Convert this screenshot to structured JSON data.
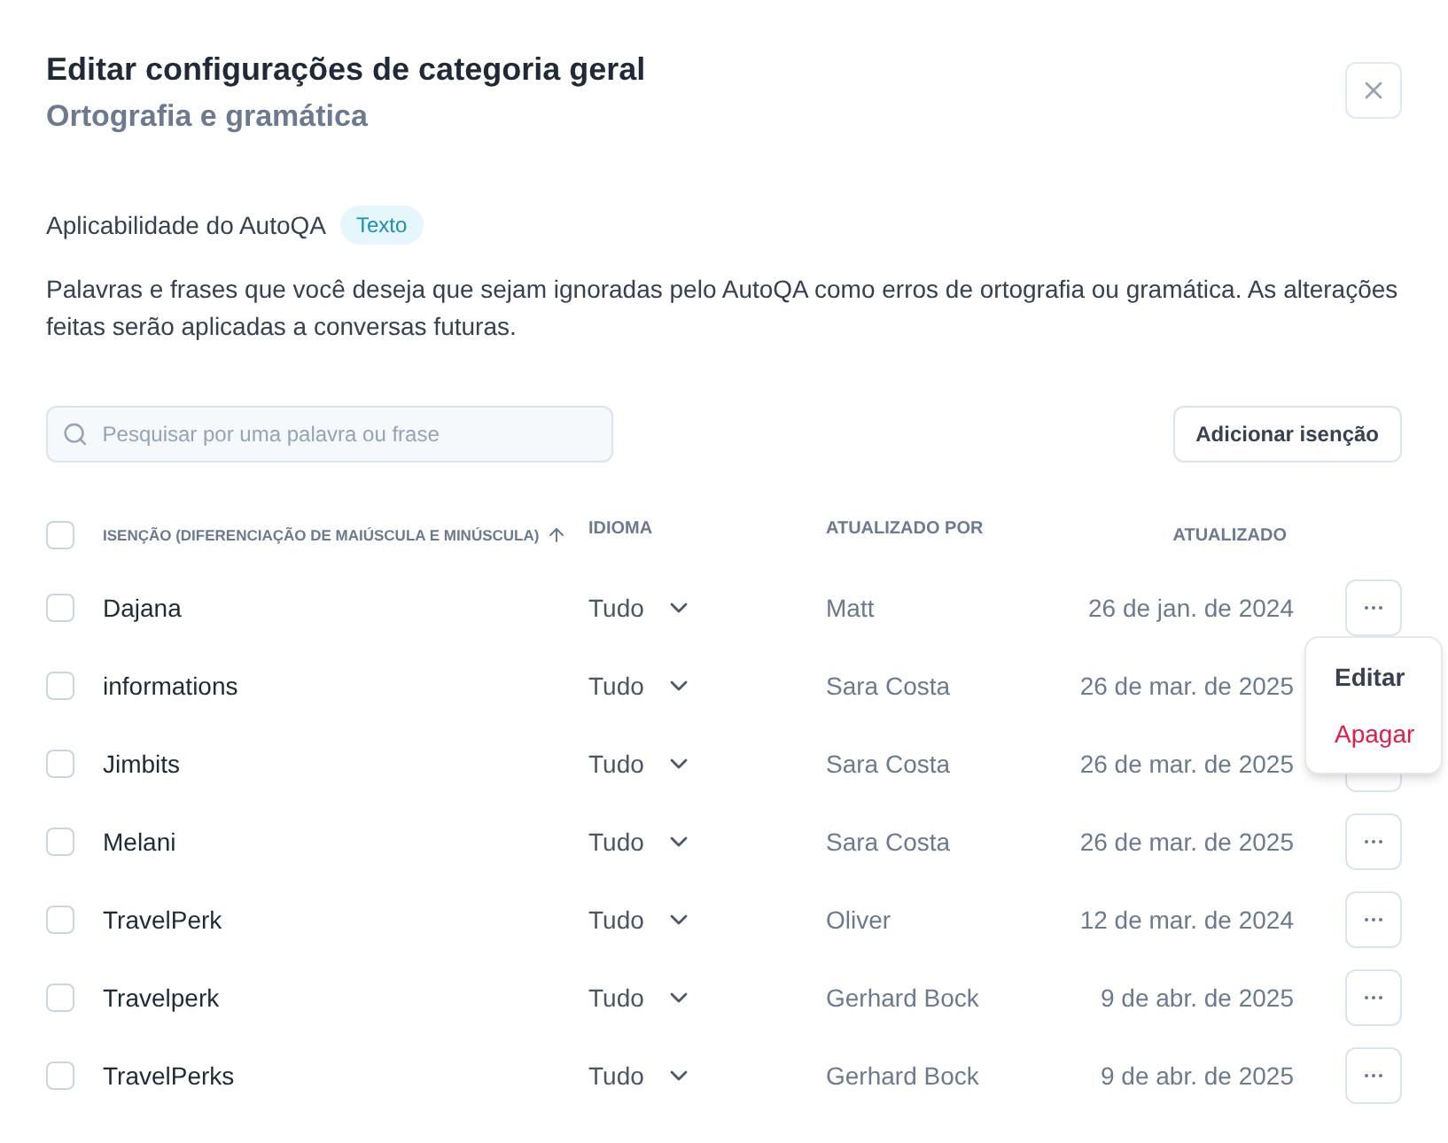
{
  "dialog": {
    "title": "Editar configurações de categoria geral",
    "subtitle": "Ortografia e gramática"
  },
  "applicability": {
    "label": "Aplicabilidade do AutoQA",
    "badge": "Texto"
  },
  "description": "Palavras e frases que você deseja que sejam ignoradas pelo AutoQA como erros de ortografia ou gramática. As alterações feitas serão aplicadas a conversas futuras.",
  "search": {
    "placeholder": "Pesquisar por uma palavra ou frase"
  },
  "add_button": "Adicionar isenção",
  "table": {
    "select_all_checked": false,
    "columns": [
      "ISENÇÃO (DIFERENCIAÇÃO DE MAIÚSCULA E MINÚSCULA)",
      "IDIOMA",
      "ATUALIZADO POR",
      "ATUALIZADO"
    ],
    "rows": [
      {
        "checked": false,
        "word": "Dajana",
        "language": "Tudo",
        "updated_by": "Matt",
        "updated": "26 de jan. de 2024"
      },
      {
        "checked": false,
        "word": "informations",
        "language": "Tudo",
        "updated_by": "Sara Costa",
        "updated": "26 de mar. de 2025"
      },
      {
        "checked": false,
        "word": "Jimbits",
        "language": "Tudo",
        "updated_by": "Sara Costa",
        "updated": "26 de mar. de 2025"
      },
      {
        "checked": false,
        "word": "Melani",
        "language": "Tudo",
        "updated_by": "Sara Costa",
        "updated": "26 de mar. de 2025"
      },
      {
        "checked": false,
        "word": "TravelPerk",
        "language": "Tudo",
        "updated_by": "Oliver",
        "updated": "12 de mar. de 2024"
      },
      {
        "checked": false,
        "word": "Travelperk",
        "language": "Tudo",
        "updated_by": "Gerhard Bock",
        "updated": "9 de abr. de 2025"
      },
      {
        "checked": false,
        "word": "TravelPerks",
        "language": "Tudo",
        "updated_by": "Gerhard Bock",
        "updated": "9 de abr. de 2025"
      }
    ]
  },
  "row_menu": {
    "items": [
      {
        "label": "Editar",
        "kind": "normal"
      },
      {
        "label": "Apagar",
        "kind": "danger"
      }
    ]
  }
}
